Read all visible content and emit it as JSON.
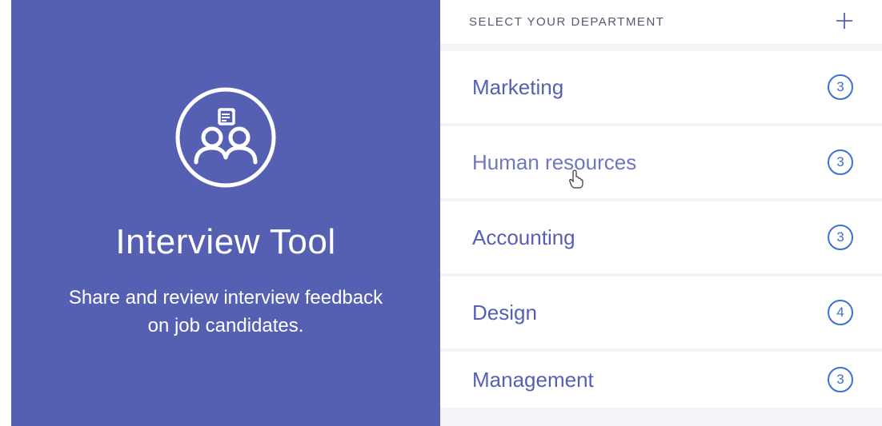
{
  "left": {
    "title": "Interview Tool",
    "subtitle": "Share and review interview feedback on job candidates."
  },
  "header": {
    "label": "SELECT YOUR DEPARTMENT"
  },
  "departments": [
    {
      "name": "Marketing",
      "count": "3"
    },
    {
      "name": "Human resources",
      "count": "3"
    },
    {
      "name": "Accounting",
      "count": "3"
    },
    {
      "name": "Design",
      "count": "4"
    },
    {
      "name": "Management",
      "count": "3"
    }
  ],
  "colors": {
    "primary": "#5660b3",
    "accent": "#3d6fd6"
  }
}
